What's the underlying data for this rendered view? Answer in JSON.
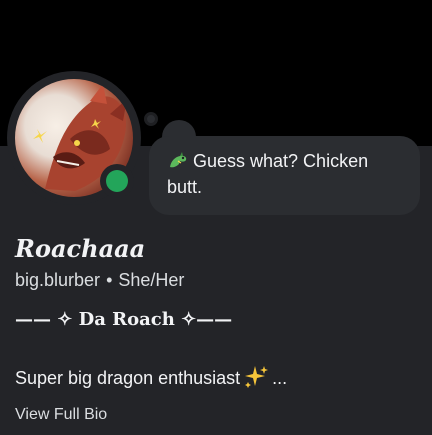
{
  "status": {
    "emoji_icon": "dragon-emoji-icon",
    "text": "Guess what? Chicken butt.",
    "online_color": "#23a55a"
  },
  "profile": {
    "display_name": "Roachaaa",
    "username": "big.blurber",
    "separator": "•",
    "pronouns": "She/Her",
    "tagline": "—— ✧ Da Roach ✧——",
    "bio_text": "Super big dragon enthusiast",
    "bio_emoji_icon": "sparkles-icon",
    "bio_ellipsis": "...",
    "view_full_bio": "View Full Bio"
  }
}
